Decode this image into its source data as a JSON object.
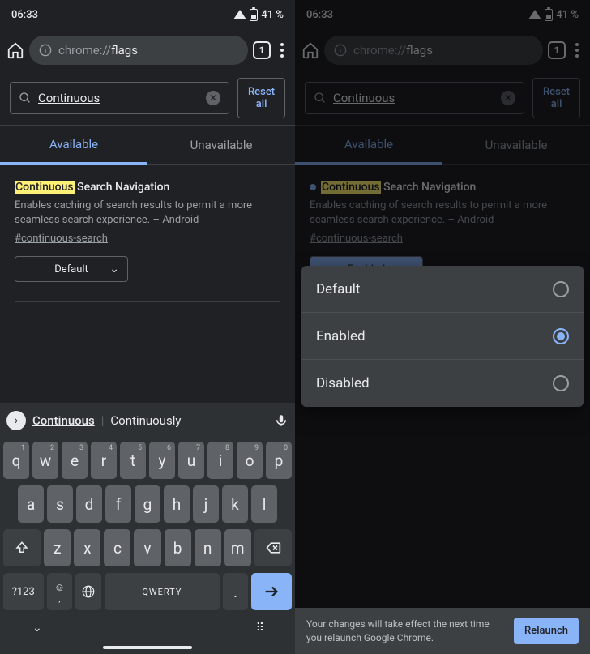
{
  "status": {
    "time": "06:33",
    "battery": "41 %"
  },
  "url": {
    "prefix": "chrome://",
    "suffix": "flags",
    "tab_count": "1"
  },
  "search": {
    "value": "Continuous",
    "reset_label": "Reset all"
  },
  "tabs": {
    "available": "Available",
    "unavailable": "Unavailable"
  },
  "flag": {
    "highlight": "Continuous",
    "title_rest": " Search Navigation",
    "desc": "Enables caching of search results to permit a more seamless search experience. – Android",
    "hash": "#continuous-search",
    "select_default": "Default",
    "select_enabled": "Enabled"
  },
  "suggest": {
    "primary": "Continuous",
    "secondary": "Continuously"
  },
  "keyboard": {
    "row1": [
      {
        "k": "q",
        "n": "1"
      },
      {
        "k": "w",
        "n": "2"
      },
      {
        "k": "e",
        "n": "3"
      },
      {
        "k": "r",
        "n": "4"
      },
      {
        "k": "t",
        "n": "5"
      },
      {
        "k": "y",
        "n": "6"
      },
      {
        "k": "u",
        "n": "7"
      },
      {
        "k": "i",
        "n": "8"
      },
      {
        "k": "o",
        "n": "9"
      },
      {
        "k": "p",
        "n": "0"
      }
    ],
    "row2": [
      "a",
      "s",
      "d",
      "f",
      "g",
      "h",
      "j",
      "k",
      "l"
    ],
    "row3": [
      "z",
      "x",
      "c",
      "v",
      "b",
      "n",
      "m"
    ],
    "sym": "?123",
    "space": "QWERTY",
    "period": "."
  },
  "popup": {
    "opt1": "Default",
    "opt2": "Enabled",
    "opt3": "Disabled"
  },
  "relaunch": {
    "msg": "Your changes will take effect the next time you relaunch Google Chrome.",
    "btn": "Relaunch"
  }
}
